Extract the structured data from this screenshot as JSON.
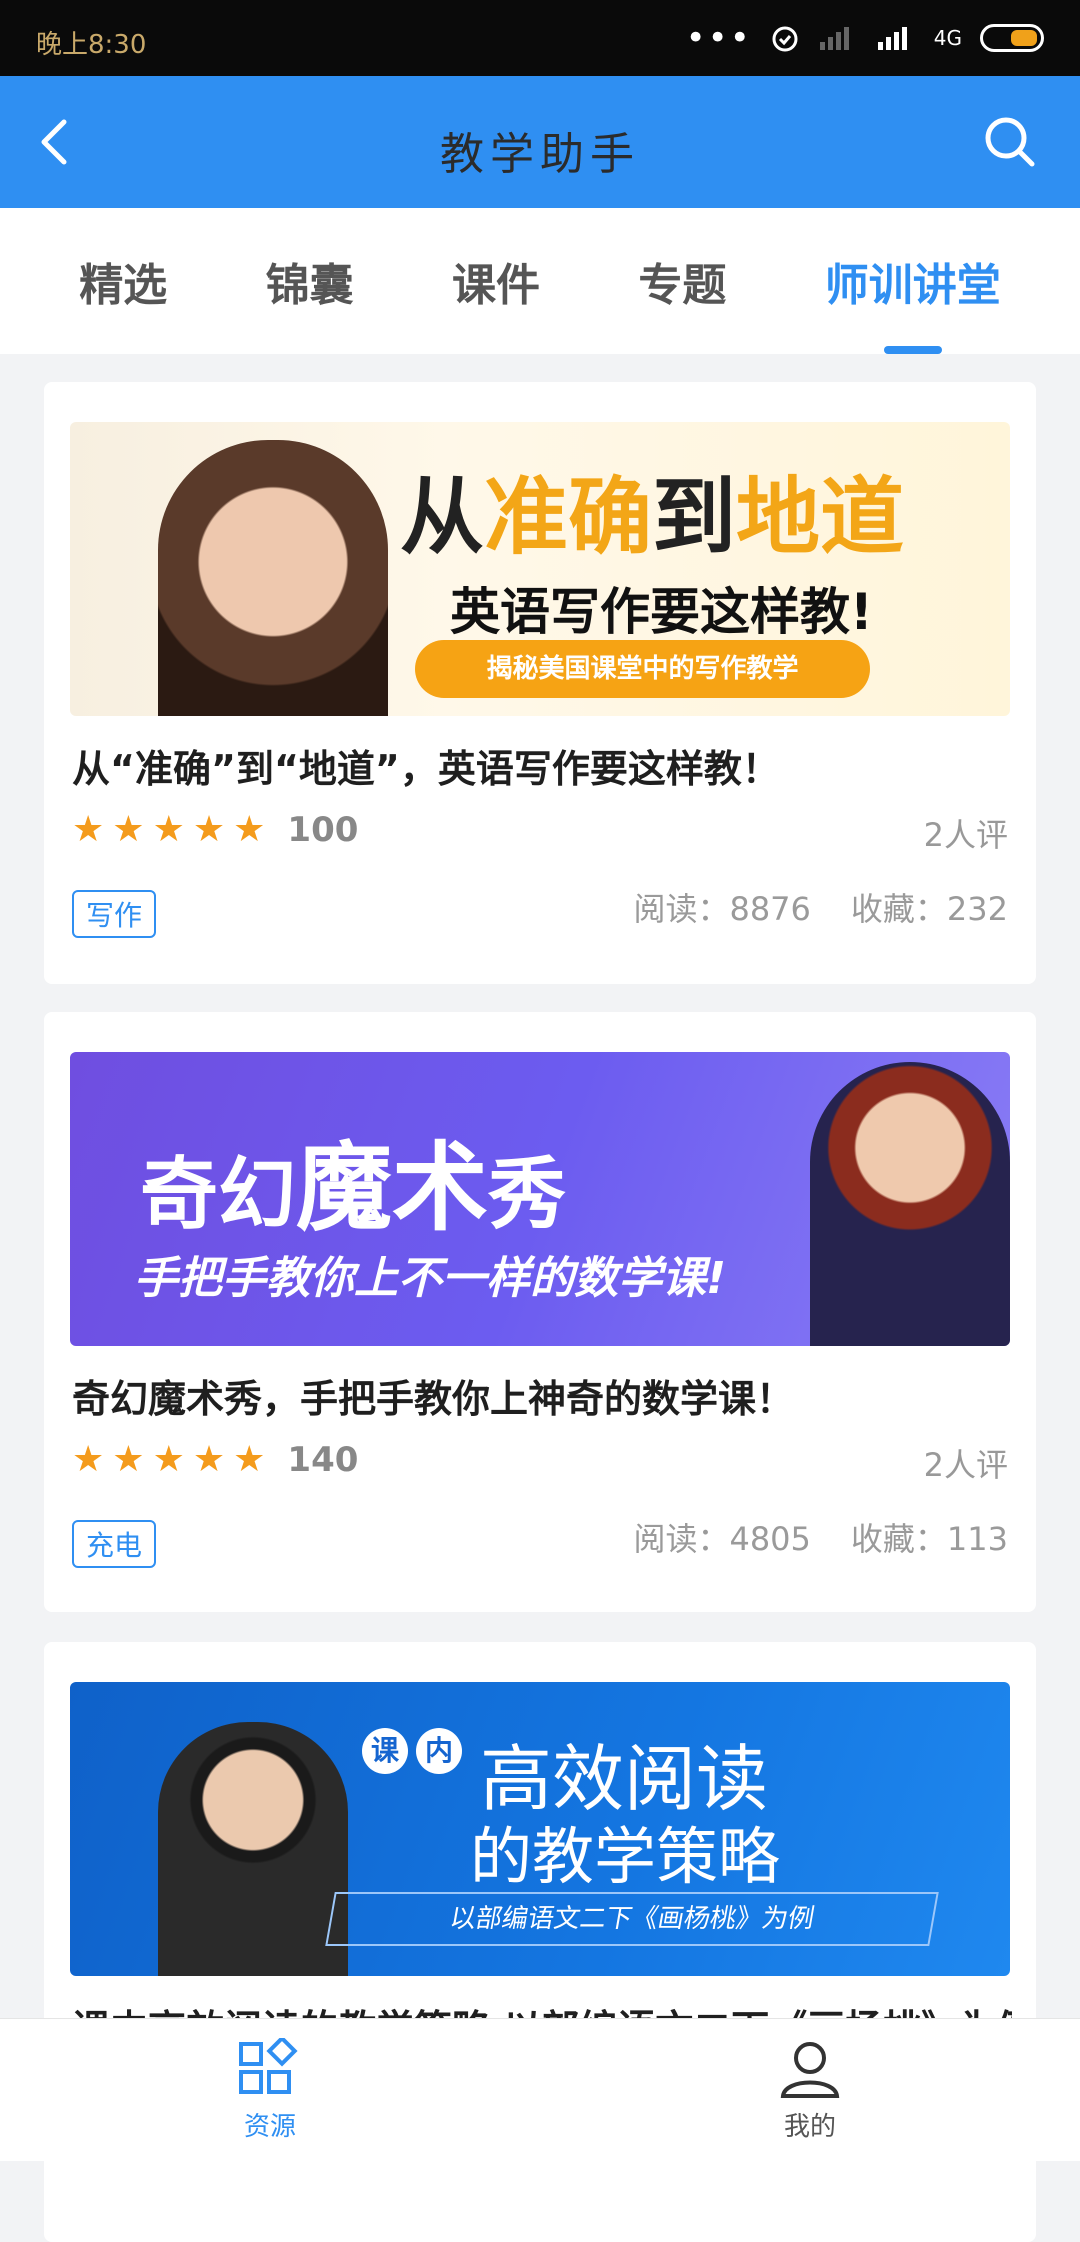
{
  "status_bar": {
    "time": "晚上8:30",
    "signal": "4G"
  },
  "header": {
    "title": "教学助手",
    "back_icon": "back-arrow-icon",
    "search_icon": "search-icon"
  },
  "tabs": [
    {
      "label": "精选",
      "active": false
    },
    {
      "label": "锦囊",
      "active": false
    },
    {
      "label": "课件",
      "active": false
    },
    {
      "label": "专题",
      "active": false
    },
    {
      "label": "师训讲堂",
      "active": true
    }
  ],
  "cards": [
    {
      "banner": {
        "h1_a": "从",
        "h1_b": "准确",
        "h1_c": "到",
        "h1_d": "地道",
        "h2": "英语写作要这样教!",
        "pill": "揭秘美国课堂中的写作教学"
      },
      "title": "从“准确”到“地道”，英语写作要这样教！",
      "rating_stars": 5,
      "score": "100",
      "reviews": "2人评",
      "tag": "写作",
      "read": "阅读：8876",
      "fav": "收藏：232"
    },
    {
      "banner": {
        "h1_a": "奇幻",
        "h1_b": "魔术",
        "h1_c": "秀",
        "h2": "手把手教你上不一样的数学课!"
      },
      "title": "奇幻魔术秀，手把手教你上神奇的数学课！",
      "rating_stars": 5,
      "score": "140",
      "reviews": "2人评",
      "tag": "充电",
      "read": "阅读：4805",
      "fav": "收藏：113"
    },
    {
      "banner": {
        "c1": "课",
        "c2": "内",
        "h1": "高效阅读",
        "h2": "的教学策略",
        "strip": "以部编语文二下《画杨桃》为例"
      },
      "title": "课内高效阅读的教学策略 以部编语文二下《画杨桃》为例"
    }
  ],
  "bottom_nav": [
    {
      "label": "资源",
      "icon": "resources-grid-icon",
      "active": true
    },
    {
      "label": "我的",
      "icon": "user-profile-icon",
      "active": false
    }
  ],
  "colors": {
    "primary": "#2f8ff2",
    "star": "#f49b1c",
    "accent_orange": "#f6a314"
  }
}
